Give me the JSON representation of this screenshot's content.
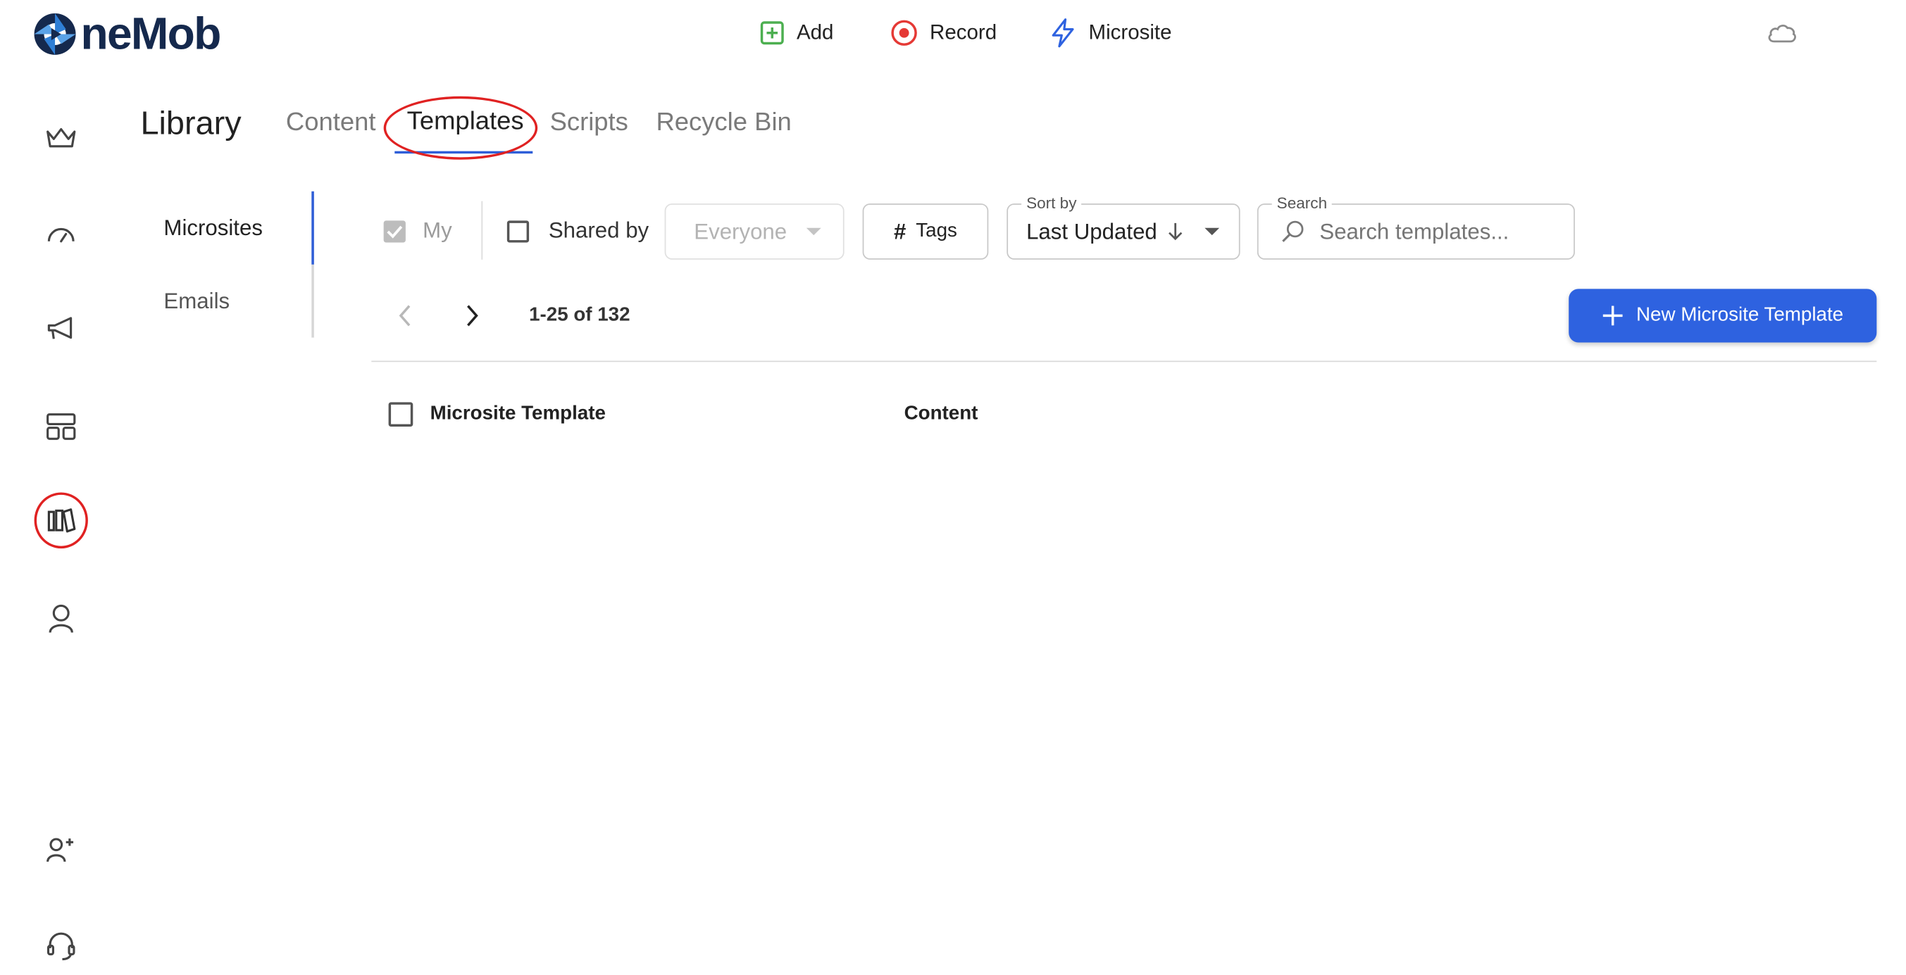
{
  "app": {
    "logo_text": "neMob"
  },
  "topbar": {
    "add_label": "Add",
    "record_label": "Record",
    "microsite_label": "Microsite",
    "cloud_icon": "cloud-icon"
  },
  "sidebar": {
    "icons": [
      "crown-icon",
      "speedometer-icon",
      "megaphone-icon",
      "layout-icon",
      "library-icon",
      "user-icon"
    ],
    "bottom_icons": [
      "add-user-icon",
      "headset-icon"
    ],
    "active": "library-icon"
  },
  "header": {
    "title": "Library",
    "tabs": [
      {
        "label": "Content",
        "active": false
      },
      {
        "label": "Templates",
        "active": true
      },
      {
        "label": "Scripts",
        "active": false
      },
      {
        "label": "Recycle Bin",
        "active": false
      }
    ]
  },
  "subnav": {
    "items": [
      {
        "label": "Microsites",
        "active": true
      },
      {
        "label": "Emails",
        "active": false
      }
    ]
  },
  "filters": {
    "my_label": "My",
    "my_checked": true,
    "shared_by_label": "Shared by",
    "shared_by_checked": false,
    "shared_by_value": "Everyone",
    "tags_label": "Tags",
    "sort_label": "Sort by",
    "sort_value": "Last Updated",
    "search_label": "Search",
    "search_placeholder": "Search templates..."
  },
  "pagination": {
    "range": "1-25 of 132"
  },
  "actions": {
    "new_template_label": "New Microsite Template"
  },
  "table": {
    "columns": [
      "Microsite Template",
      "Content"
    ]
  },
  "colors": {
    "brand_navy": "#15294d",
    "accent_blue": "#2e62e0",
    "add_green": "#4caf50",
    "record_red": "#e53935",
    "annotation_red": "#e02222"
  }
}
